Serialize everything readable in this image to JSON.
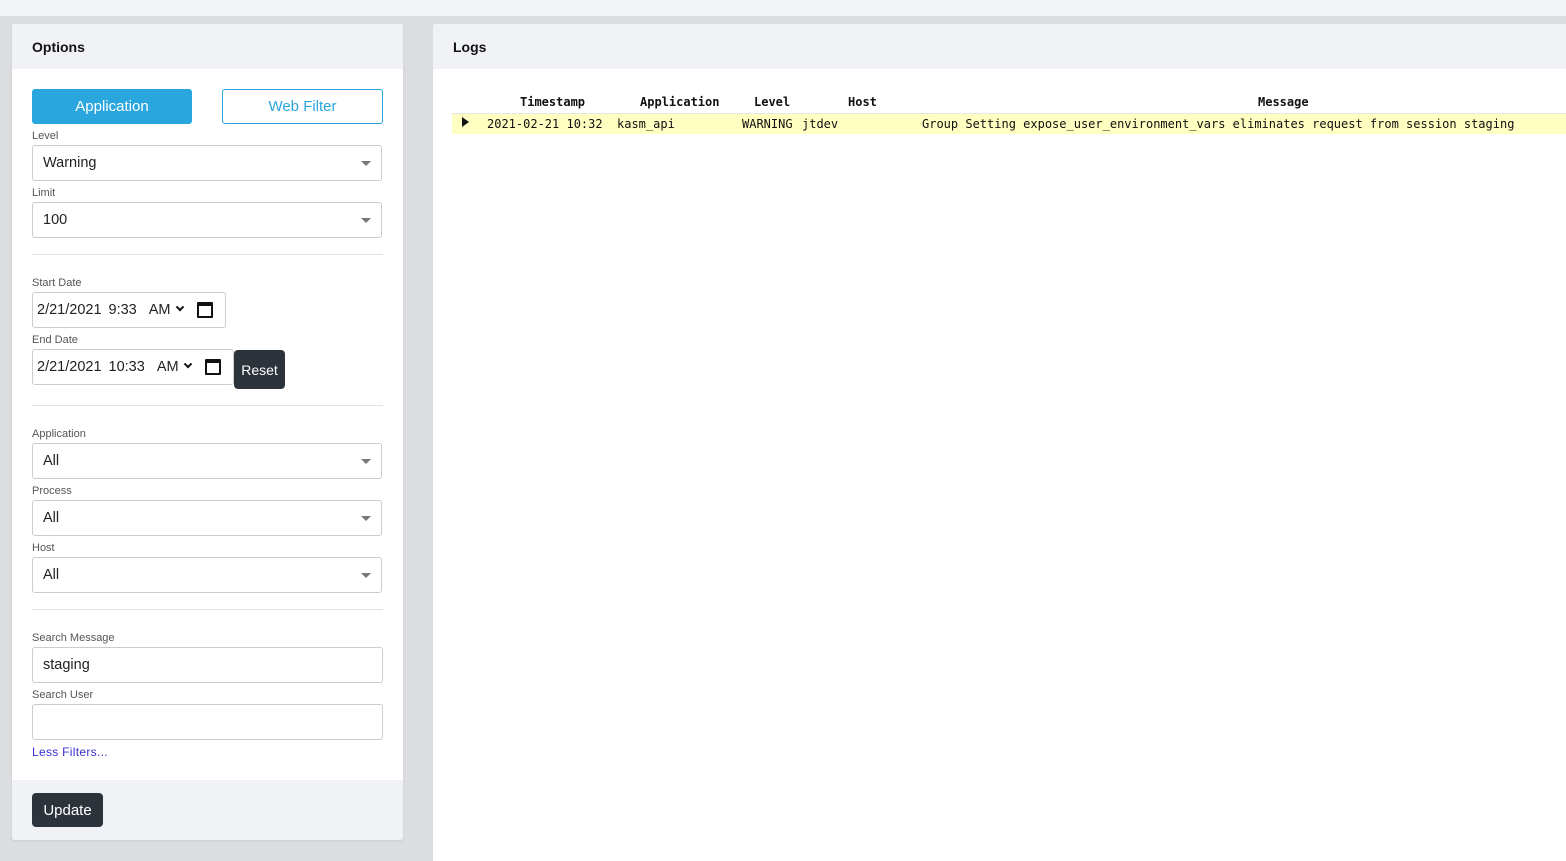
{
  "options": {
    "title": "Options",
    "tabs": {
      "application": "Application",
      "web_filter": "Web Filter"
    },
    "level": {
      "label": "Level",
      "value": "Warning"
    },
    "limit": {
      "label": "Limit",
      "value": "100"
    },
    "start_date": {
      "label": "Start Date",
      "date": "2/21/2021",
      "time": "9:33",
      "ampm": "AM"
    },
    "end_date": {
      "label": "End Date",
      "date": "2/21/2021",
      "time": "10:33",
      "ampm": "AM"
    },
    "reset_label": "Reset",
    "application": {
      "label": "Application",
      "value": "All"
    },
    "process": {
      "label": "Process",
      "value": "All"
    },
    "host": {
      "label": "Host",
      "value": "All"
    },
    "search_message": {
      "label": "Search Message",
      "value": "staging"
    },
    "search_user": {
      "label": "Search User",
      "value": ""
    },
    "less_filters": "Less Filters...",
    "update_label": "Update"
  },
  "logs": {
    "title": "Logs",
    "columns": [
      "Timestamp",
      "Application",
      "Level",
      "Host",
      "Message"
    ],
    "rows": [
      {
        "timestamp": "2021-02-21 10:32",
        "application": "kasm_api",
        "level": "WARNING",
        "host": "jtdev",
        "message": "Group Setting expose_user_environment_vars eliminates request from session staging"
      }
    ],
    "highlight_color": "#ffffc1"
  },
  "colors": {
    "accent": "#2aa6df",
    "dark_button": "#2c333a"
  }
}
